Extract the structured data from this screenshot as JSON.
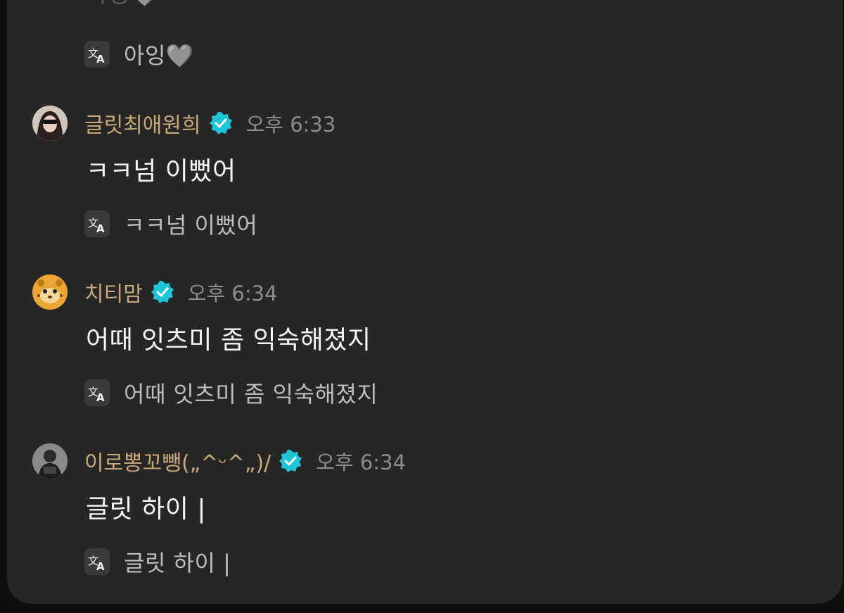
{
  "partial_top": {
    "text": "아잉",
    "emoji": "🩶"
  },
  "first_translation": {
    "text": "아잉",
    "emoji": "🩶"
  },
  "messages": [
    {
      "username": "글릿최애원희",
      "time": "오후 6:33",
      "text": "ㅋㅋ넘 이뻤어",
      "translation": "ㅋㅋ넘 이뻤어",
      "avatar": "avatar-sunglasses"
    },
    {
      "username": "치티맘",
      "time": "오후 6:34",
      "text": "어때 잇츠미 좀 익숙해졌지",
      "translation": "어때 잇츠미 좀 익숙해졌지",
      "avatar": "avatar-cheetah"
    },
    {
      "username": "이로뽕꼬뺑(„^ᵕ^„)/",
      "time": "오후 6:34",
      "text": "글릿 하이 |",
      "translation": "글릿 하이 |",
      "avatar": "avatar-person"
    }
  ],
  "icons": {
    "translate": "translate-icon",
    "verified": "verified-badge-icon"
  },
  "colors": {
    "panel": "#262626",
    "username": "#c9a878",
    "verified": "#1fc4d6",
    "message": "#f5f5f5",
    "translation": "#bdbdbd",
    "time": "#8c8c8c"
  }
}
